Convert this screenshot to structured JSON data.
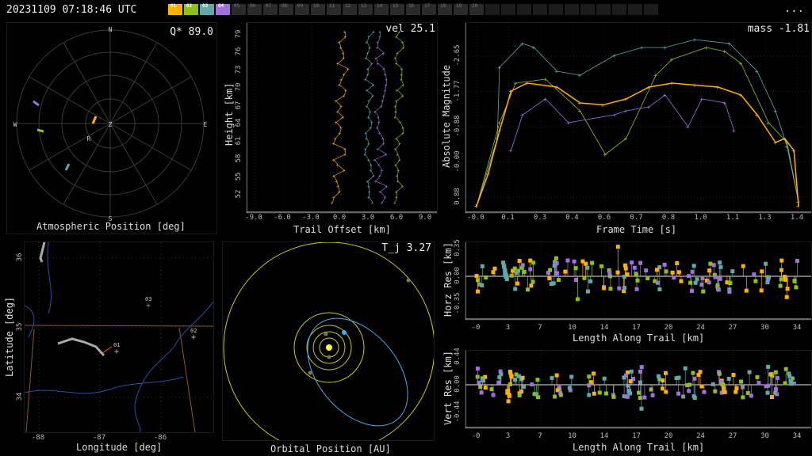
{
  "header": {
    "timestamp": "20231109 07:18:46 UTC",
    "menu_label": "..."
  },
  "stations": [
    {
      "label": "01",
      "color": "#ffb000",
      "active": true
    },
    {
      "label": "02",
      "color": "#8fbf1f",
      "active": true
    },
    {
      "label": "03",
      "color": "#5fa9a9",
      "active": true
    },
    {
      "label": "04",
      "color": "#a070e0",
      "active": true
    },
    {
      "label": "05",
      "color": "#2a2a2a",
      "active": false
    },
    {
      "label": "06",
      "color": "#2a2a2a",
      "active": false
    },
    {
      "label": "07",
      "color": "#2a2a2a",
      "active": false
    },
    {
      "label": "08",
      "color": "#2a2a2a",
      "active": false
    },
    {
      "label": "09",
      "color": "#2a2a2a",
      "active": false
    },
    {
      "label": "10",
      "color": "#2a2a2a",
      "active": false
    },
    {
      "label": "11",
      "color": "#2a2a2a",
      "active": false
    },
    {
      "label": "12",
      "color": "#2a2a2a",
      "active": false
    },
    {
      "label": "13",
      "color": "#2a2a2a",
      "active": false
    },
    {
      "label": "14",
      "color": "#2a2a2a",
      "active": false
    },
    {
      "label": "15",
      "color": "#2a2a2a",
      "active": false
    },
    {
      "label": "16",
      "color": "#2a2a2a",
      "active": false
    },
    {
      "label": "17",
      "color": "#2a2a2a",
      "active": false
    },
    {
      "label": "18",
      "color": "#2a2a2a",
      "active": false
    },
    {
      "label": "19",
      "color": "#2a2a2a",
      "active": false
    },
    {
      "label": "20",
      "color": "#2a2a2a",
      "active": false
    },
    {
      "label": "",
      "color": "#1c1c1c",
      "active": false
    },
    {
      "label": "",
      "color": "#1c1c1c",
      "active": false
    },
    {
      "label": "",
      "color": "#1c1c1c",
      "active": false
    },
    {
      "label": "",
      "color": "#1c1c1c",
      "active": false
    },
    {
      "label": "",
      "color": "#1c1c1c",
      "active": false
    },
    {
      "label": "",
      "color": "#1c1c1c",
      "active": false
    },
    {
      "label": "",
      "color": "#1c1c1c",
      "active": false
    },
    {
      "label": "",
      "color": "#1c1c1c",
      "active": false
    },
    {
      "label": "",
      "color": "#1c1c1c",
      "active": false
    },
    {
      "label": "",
      "color": "#1c1c1c",
      "active": false
    },
    {
      "label": "",
      "color": "#1c1c1c",
      "active": false
    }
  ],
  "colors": {
    "s01": "#ffb000",
    "s02": "#8fbf1f",
    "s03": "#5fa9a9",
    "s04": "#a070e0",
    "grid": "#3a3a3a",
    "axis": "#cfcfcf"
  },
  "atmos": {
    "title": "Atmospheric Position [deg]",
    "readout": "Q* 89.0",
    "compass": {
      "n": "N",
      "s": "S",
      "e": "E",
      "w": "W",
      "z": "Z",
      "r": "R"
    }
  },
  "trail": {
    "title": "Trail Offset [km]",
    "ylabel": "Height [km]",
    "readout": "vel 25.1",
    "xticks": [
      "-9.0",
      "-6.0",
      "-3.0",
      "0.0",
      "3.0",
      "6.0",
      "9.0"
    ],
    "yticks": [
      "79",
      "76",
      "73",
      "70",
      "67",
      "64",
      "61",
      "58",
      "55",
      "52"
    ]
  },
  "mag": {
    "title": "Frame Time [s]",
    "ylabel": "Absolute Magnitude",
    "readout": "mass -1.81",
    "xticks": [
      "-0.0",
      "0.1",
      "0.3",
      "0.4",
      "0.6",
      "0.7",
      "0.8",
      "1.0",
      "1.1",
      "1.3",
      "1.4"
    ],
    "yticks": [
      "-2.65",
      "-1.77",
      "-0.88",
      "-0.00",
      "0.88"
    ]
  },
  "map": {
    "title": "Longitude [deg]",
    "ylabel": "Latitude [deg]",
    "xticks": [
      "-88",
      "-87",
      "-86"
    ],
    "yticks": [
      "36",
      "35",
      "34"
    ],
    "stations": [
      {
        "label": "01"
      },
      {
        "label": "02"
      },
      {
        "label": "03"
      }
    ]
  },
  "orbit": {
    "title": "Orbital Position [AU]",
    "readout": "T_j 3.27"
  },
  "hres": {
    "title": "Length Along Trail [km]",
    "ylabel": "Horz Res [km]",
    "xticks": [
      "-0",
      "3",
      "7",
      "10",
      "14",
      "17",
      "20",
      "24",
      "27",
      "30",
      "34"
    ],
    "yticks": [
      "0.35",
      "0.00",
      "-0.35"
    ]
  },
  "vres": {
    "title": "Length Along Trail [km]",
    "ylabel": "Vert Res [km]",
    "xticks": [
      "-0",
      "3",
      "7",
      "10",
      "14",
      "17",
      "20",
      "24",
      "27",
      "30",
      "34"
    ],
    "yticks": [
      "0.44",
      "0.00",
      "-0.44"
    ]
  }
}
